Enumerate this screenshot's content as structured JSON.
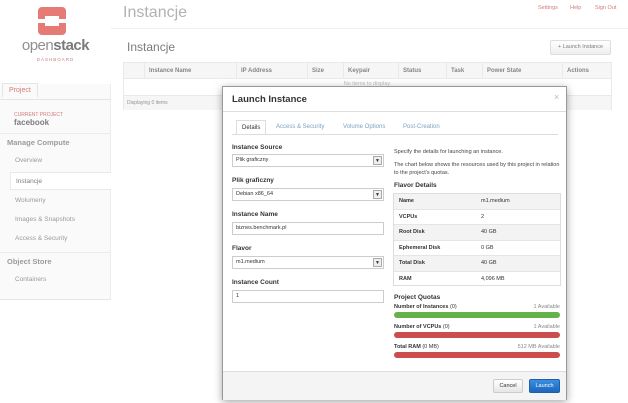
{
  "brand": {
    "name_part1": "open",
    "name_part2": "stack",
    "tagline": "DASHBOARD",
    "accent": "#d9342b"
  },
  "sidebar": {
    "project_tab": "Project",
    "current_project_label": "CURRENT PROJECT",
    "current_project_name": "facebook",
    "manage_compute_title": "Manage Compute",
    "items": [
      {
        "label": "Overview"
      },
      {
        "label": "Instancje"
      },
      {
        "label": "Wolumeny"
      },
      {
        "label": "Images & Snapshots"
      },
      {
        "label": "Access & Security"
      }
    ],
    "object_store_title": "Object Store",
    "object_store_items": [
      {
        "label": "Containers"
      }
    ]
  },
  "header": {
    "title": "Instancje",
    "links": [
      "Settings",
      "Help",
      "Sign Out"
    ]
  },
  "main": {
    "subtitle": "Instancje",
    "launch_button": "+ Launch Instance",
    "table": {
      "columns": [
        "Instance Name",
        "IP Address",
        "Size",
        "Keypair",
        "Status",
        "Task",
        "Power State",
        "Actions"
      ],
      "empty_text": "No items to display.",
      "footer": "Displaying 0 items"
    }
  },
  "modal": {
    "title": "Launch Instance",
    "close": "×",
    "tabs": [
      "Details",
      "Access & Security",
      "Volume Options",
      "Post-Creation"
    ],
    "fields": {
      "source_label": "Instance Source",
      "source_value": "Plik graficzny",
      "image_label": "Plik graficzny",
      "image_value": "Debian x86_64",
      "name_label": "Instance Name",
      "name_value": "biznes.benchmark.pl",
      "flavor_label": "Flavor",
      "flavor_value": "m1.medium",
      "count_label": "Instance Count",
      "count_value": "1"
    },
    "help": {
      "line1": "Specify the details for launching an instance.",
      "line2": "The chart below shows the resources used by this project in relation to the project's quotas."
    },
    "flavor_details": {
      "title": "Flavor Details",
      "rows": [
        {
          "key": "Name",
          "value": "m1.medium"
        },
        {
          "key": "VCPUs",
          "value": "2"
        },
        {
          "key": "Root Disk",
          "value": "40 GB"
        },
        {
          "key": "Ephemeral Disk",
          "value": "0 GB"
        },
        {
          "key": "Total Disk",
          "value": "40 GB"
        },
        {
          "key": "RAM",
          "value": "4,096 MB"
        }
      ]
    },
    "quotas": {
      "title": "Project Quotas",
      "items": [
        {
          "label": "Number of Instances",
          "used": "(0)",
          "available": "1 Available",
          "color": "#64b24a"
        },
        {
          "label": "Number of VCPUs",
          "used": "(0)",
          "available": "1 Available",
          "color": "#cc4d4d"
        },
        {
          "label": "Total RAM",
          "used": "(0 MB)",
          "available": "512 MB Available",
          "color": "#cc4d4d"
        }
      ]
    },
    "buttons": {
      "cancel": "Cancel",
      "launch": "Launch"
    }
  }
}
